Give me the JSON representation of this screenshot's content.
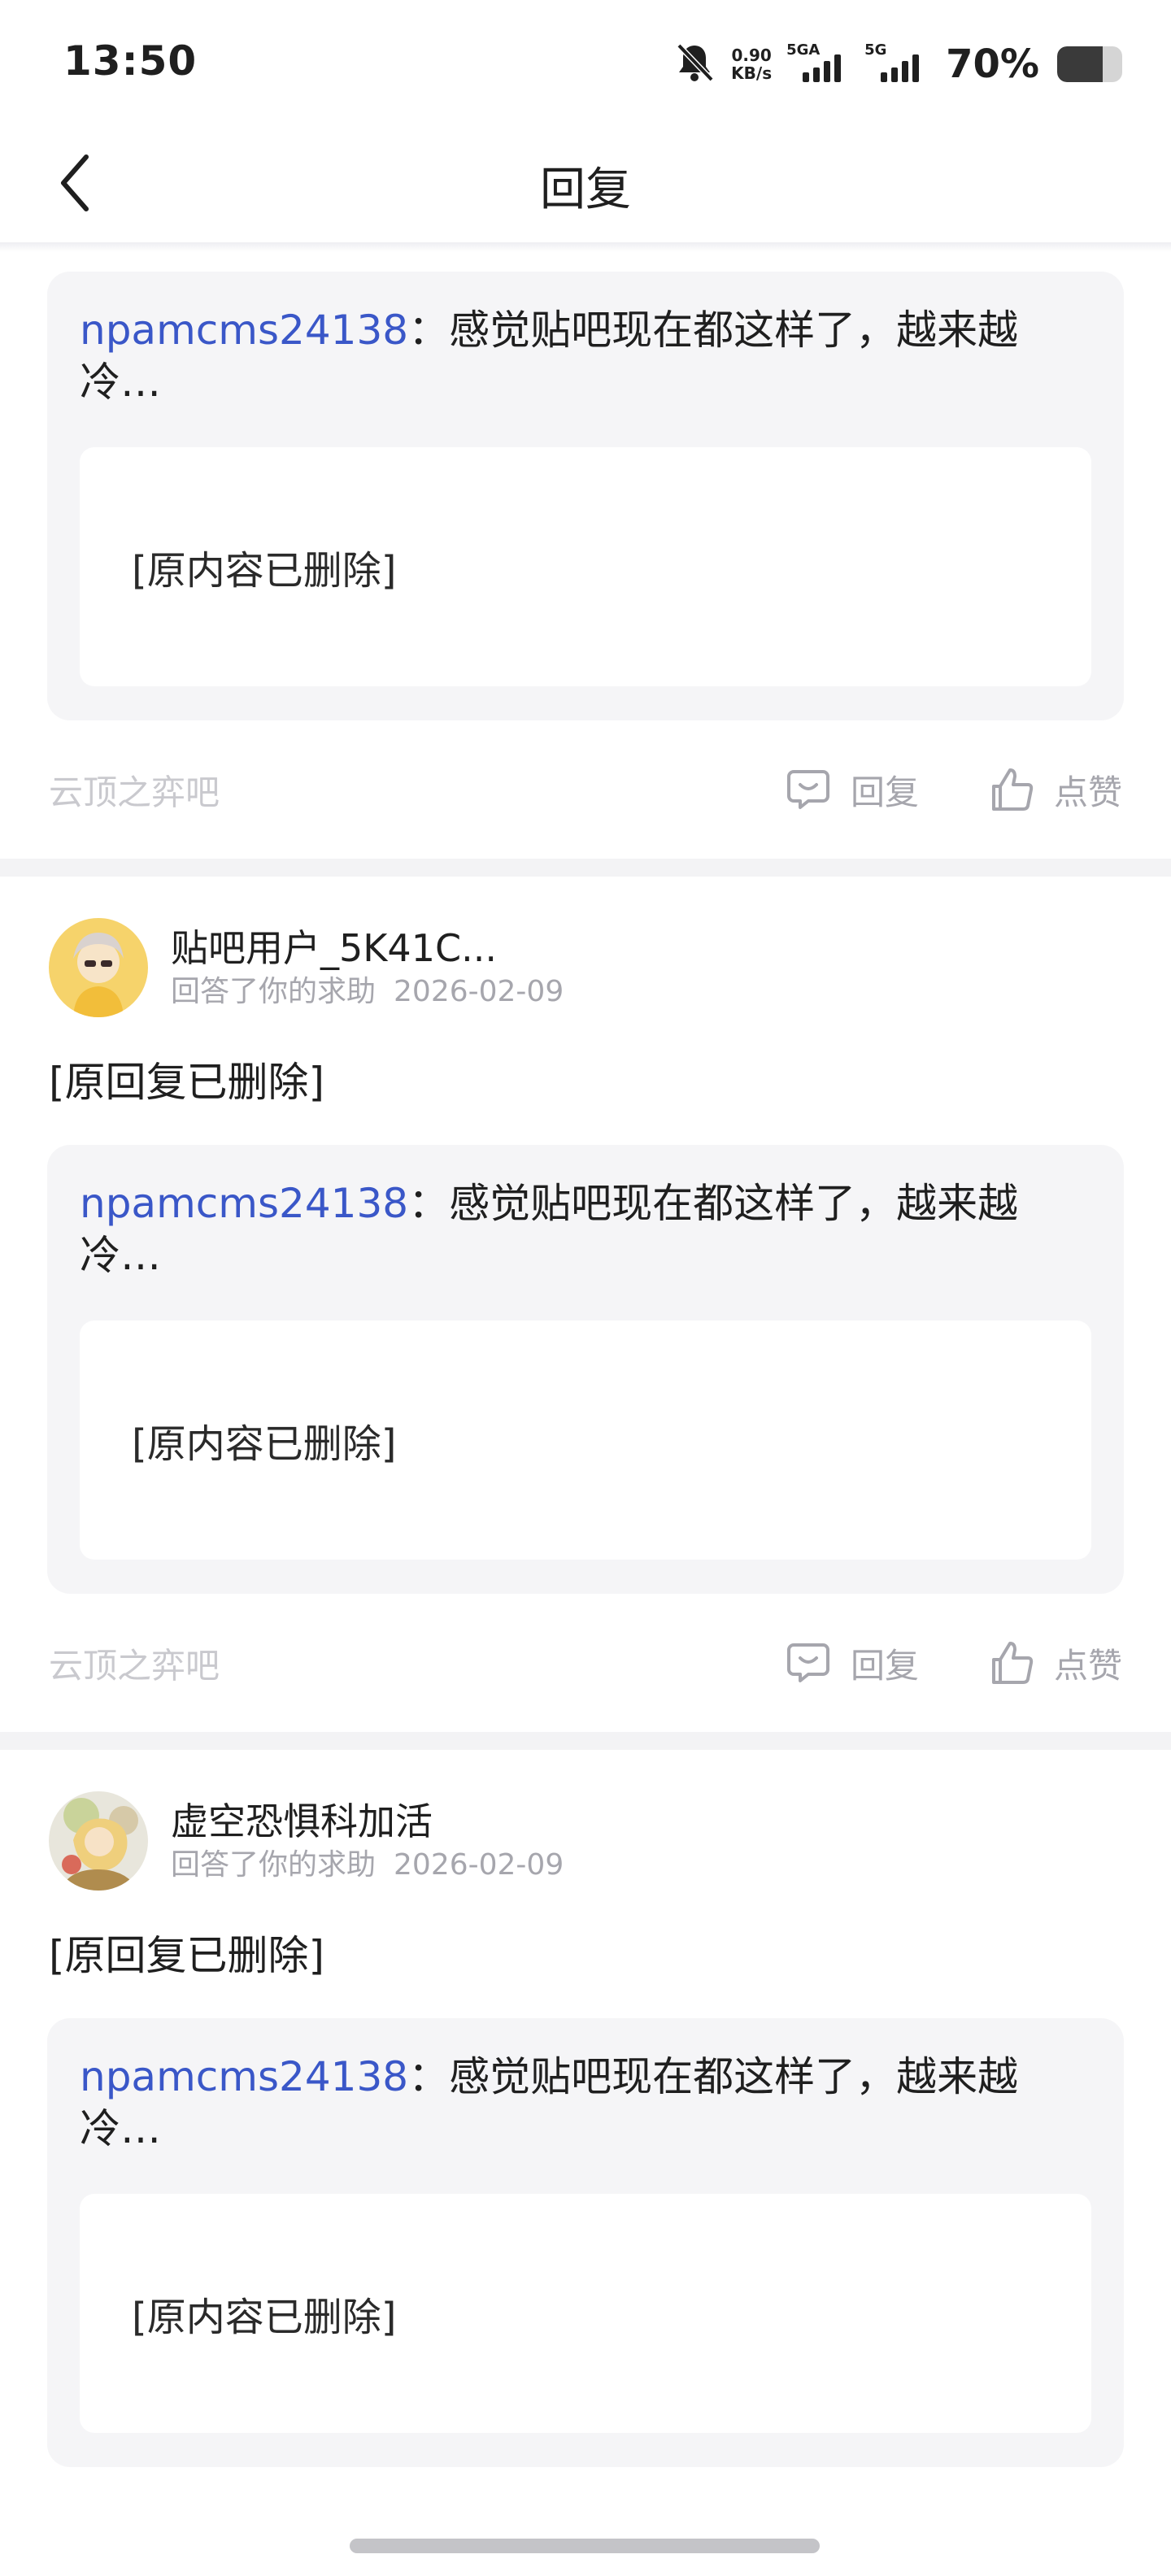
{
  "status_bar": {
    "time": "13:50",
    "net_speed_value": "0.90",
    "net_speed_unit": "KB/s",
    "sim1_label": "5GA",
    "sim2_label": "5G",
    "battery_percent": "70%",
    "battery_level": 0.7,
    "icons": [
      "bell-muted-icon",
      "signal-icon",
      "battery-icon"
    ]
  },
  "header": {
    "title": "回复",
    "back_icon": "chevron-left-icon"
  },
  "posts": [
    {
      "quote_user": "npamcms24138",
      "quote_text": "：感觉贴吧现在都这样了，越来越冷…",
      "quote_inner": "[原内容已删除]",
      "forum": "云顶之弈吧",
      "reply_label": "回复",
      "like_label": "点赞"
    },
    {
      "username": "贴吧用户_5K41C...",
      "action_text": "回答了你的求助",
      "date": "2026-02-09",
      "reply_text": "[原回复已删除]",
      "quote_user": "npamcms24138",
      "quote_text": "：感觉贴吧现在都这样了，越来越冷…",
      "quote_inner": "[原内容已删除]",
      "forum": "云顶之弈吧",
      "reply_label": "回复",
      "like_label": "点赞"
    },
    {
      "username": "虚空恐惧科加活",
      "action_text": "回答了你的求助",
      "date": "2026-02-09",
      "reply_text": "[原回复已删除]",
      "quote_user": "npamcms24138",
      "quote_text": "：感觉贴吧现在都这样了，越来越冷…",
      "quote_inner": "[原内容已删除]"
    }
  ],
  "colors": {
    "link_blue": "#3a57c8",
    "muted_gray": "#a6a6ad",
    "quote_bg": "#f5f5f7",
    "separator": "#f3f3f5"
  }
}
